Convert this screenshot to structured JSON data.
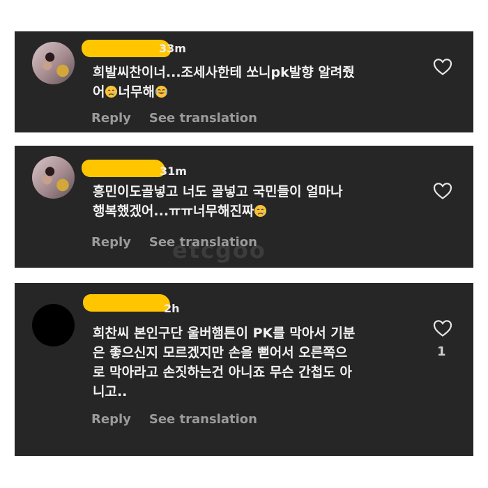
{
  "comments": [
    {
      "time": "33m",
      "lines": [
        "희발씨찬이너...조세사한테 쏘니pk발향 알려줬",
        "어",
        "너무해"
      ],
      "reply_label": "Reply",
      "translation_label": "See translation",
      "likes": ""
    },
    {
      "time": "31m",
      "lines": [
        "흥민이도골넣고 너도 골넣고 국민들이 얼마나",
        "행복했겠어...ㅠㅠ너무해진짜"
      ],
      "reply_label": "Reply",
      "translation_label": "See translation",
      "likes": ""
    },
    {
      "time": "2h",
      "lines": [
        "희찬씨 본인구단 울버햄튼이 PK를 막아서 기분",
        "은 좋으신지 모르겠지만 손을 뻗어서 오른쪽으",
        "로 막아라고 손짓하는건 아니죠 무슨 간첩도 아",
        "니고.."
      ],
      "reply_label": "Reply",
      "translation_label": "See translation",
      "likes": "1"
    }
  ],
  "watermark": "etcgoo",
  "colors": {
    "card_background": "#262626",
    "censor_blob": "#ffc600",
    "comment_text": "#f2f2f2",
    "meta_text": "#9b9b9b"
  },
  "icons": {
    "heart": "heart-outline-icon",
    "crying": "crying-face-emoji",
    "laughing": "tears-of-joy-emoji"
  }
}
